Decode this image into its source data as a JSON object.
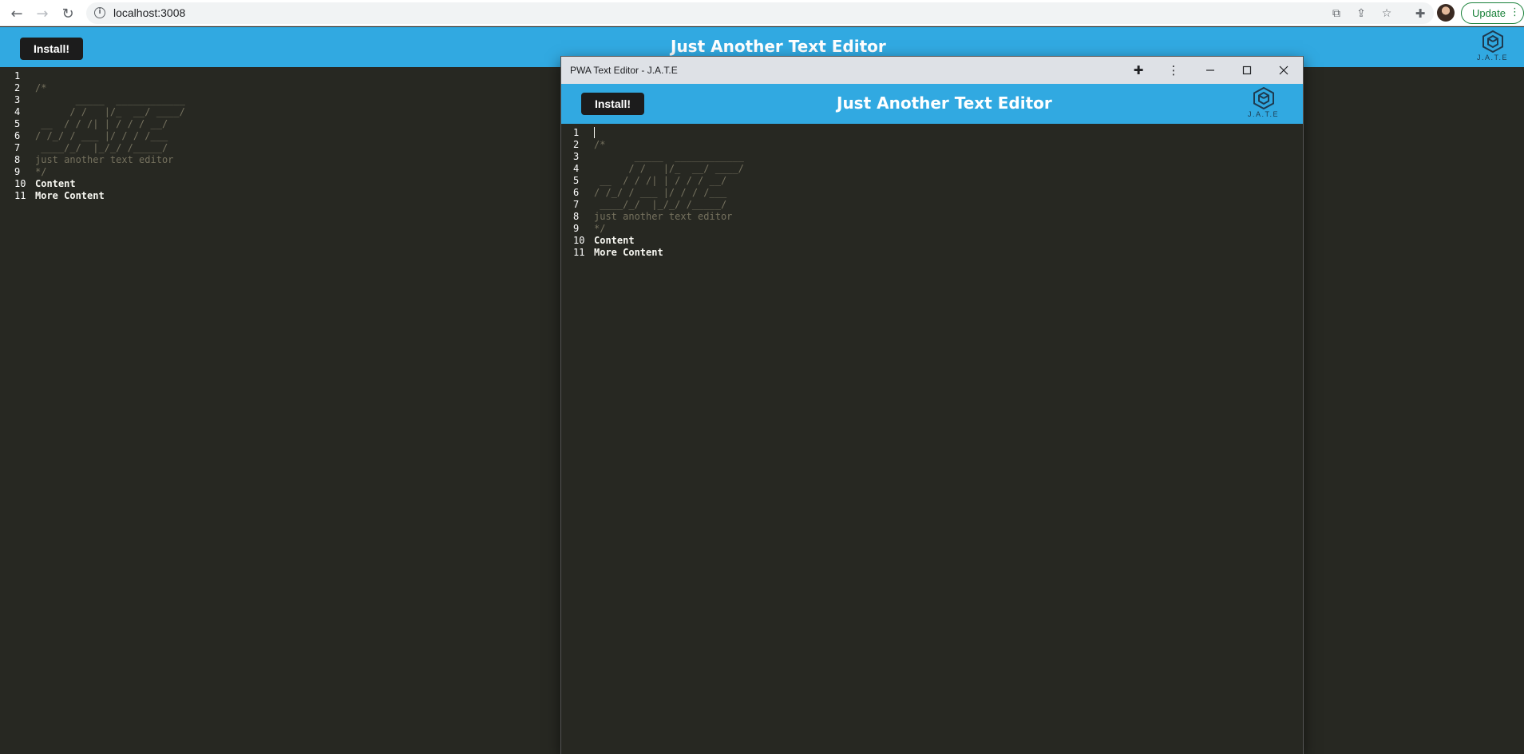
{
  "browser": {
    "url": "localhost:3008",
    "update_label": "Update",
    "icons": {
      "back": "back-arrow-icon",
      "forward": "forward-arrow-icon",
      "reload": "reload-icon",
      "info": "site-info-icon",
      "open_in_app": "open-in-app-icon",
      "share": "share-icon",
      "bookmark": "bookmark-star-icon",
      "extensions": "puzzle-icon",
      "profile": "avatar"
    }
  },
  "app": {
    "install_label": "Install!",
    "title": "Just Another Text Editor",
    "logo_text": "J.A.T.E",
    "colors": {
      "header": "#31a9e1",
      "editor_bg": "#272822",
      "comment": "#75715e",
      "text": "#f8f8f2"
    }
  },
  "editor": {
    "lines": [
      {
        "n": "1",
        "text": "",
        "type": "code"
      },
      {
        "n": "2",
        "text": "/*",
        "type": "comment"
      },
      {
        "n": "3",
        "text": "       _____  ____________",
        "type": "comment"
      },
      {
        "n": "4",
        "text": "      / /   |/_  __/ ____/",
        "type": "comment"
      },
      {
        "n": "5",
        "text": " __  / / /| | / / / __/",
        "type": "comment"
      },
      {
        "n": "6",
        "text": "/ /_/ / ___ |/ / / /___",
        "type": "comment"
      },
      {
        "n": "7",
        "text": " ____/_/  |_/_/ /_____/",
        "type": "comment"
      },
      {
        "n": "8",
        "text": "just another text editor",
        "type": "comment"
      },
      {
        "n": "9",
        "text": "*/",
        "type": "comment"
      },
      {
        "n": "10",
        "text": "Content",
        "type": "code"
      },
      {
        "n": "11",
        "text": "More Content",
        "type": "code"
      }
    ]
  },
  "pwa_window": {
    "title": "PWA Text Editor - J.A.T.E",
    "controls": [
      "puzzle-icon",
      "more-menu-icon",
      "minimize-icon",
      "maximize-icon",
      "close-icon"
    ]
  }
}
